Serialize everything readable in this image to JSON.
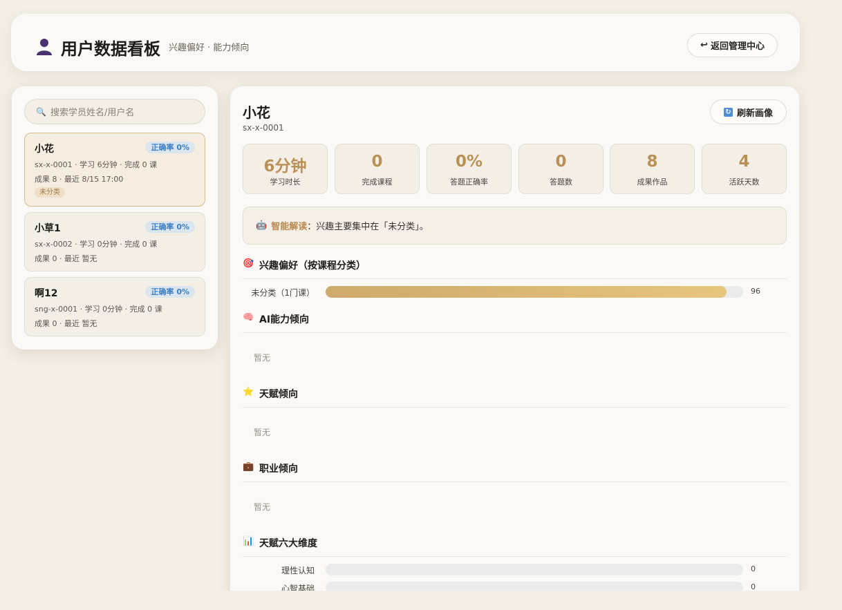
{
  "header": {
    "title": "用户数据看板",
    "subtitle": "兴趣偏好 · 能力倾向",
    "back_label": "返回管理中心"
  },
  "sidebar": {
    "search_placeholder": "搜索学员姓名/用户名",
    "students": [
      {
        "name": "小花",
        "accuracy": "正确率 0%",
        "line1": "sx-x-0001 · 学习 6分钟 · 完成 0 课",
        "line2": "成果 8 · 最近 8/15 17:00",
        "tag": "未分类"
      },
      {
        "name": "小草1",
        "accuracy": "正确率 0%",
        "line1": "sx-x-0002 · 学习 0分钟 · 完成 0 课",
        "line2": "成果 0 · 最近 暂无"
      },
      {
        "name": "啊12",
        "accuracy": "正确率 0%",
        "line1": "sng-x-0001 · 学习 0分钟 · 完成 0 课",
        "line2": "成果 0 · 最近 暂无"
      }
    ]
  },
  "profile": {
    "name": "小花",
    "uid": "sx-x-0001",
    "refresh_label": "刷新画像",
    "stats": [
      {
        "value": "6分钟",
        "label": "学习时长"
      },
      {
        "value": "0",
        "label": "完成课程"
      },
      {
        "value": "0%",
        "label": "答题正确率"
      },
      {
        "value": "0",
        "label": "答题数"
      },
      {
        "value": "8",
        "label": "成果作品"
      },
      {
        "value": "4",
        "label": "活跃天数"
      }
    ],
    "insight_label": "智能解读",
    "insight_text": "：兴趣主要集中在「未分类」。"
  },
  "sections": {
    "interest_title": "兴趣偏好（按课程分类）",
    "interest_bars": [
      {
        "label": "未分类（1门课）",
        "value": 96,
        "display": "96"
      }
    ],
    "ai_title": "AI能力倾向",
    "ai_empty": "暂无",
    "talent_title": "天赋倾向",
    "talent_empty": "暂无",
    "career_title": "职业倾向",
    "career_empty": "暂无",
    "six_title": "天赋六大维度",
    "six_bars": [
      {
        "label": "理性认知",
        "value": 0,
        "display": "0"
      },
      {
        "label": "心智基础",
        "value": 0,
        "display": "0"
      }
    ]
  },
  "colors": {
    "accent": "#b99155",
    "badge_text": "#3d7fc3",
    "bar_fill_start": "#cea96b",
    "bar_fill_end": "#e6c67f"
  },
  "icons": {
    "header": "user-icon",
    "back": "return-arrow-icon",
    "search": "search-icon",
    "refresh": "refresh-icon",
    "insight": "robot-icon",
    "interest": "target-icon",
    "ai": "brain-icon",
    "talent": "star-icon",
    "career": "briefcase-icon",
    "six": "bar-chart-icon"
  }
}
